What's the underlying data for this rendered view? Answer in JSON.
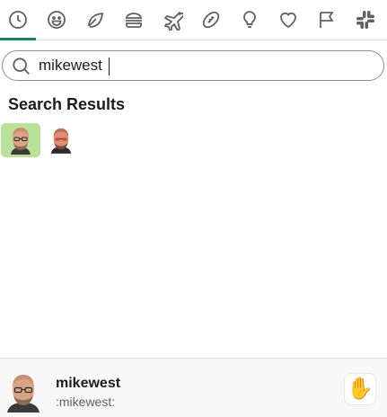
{
  "tabs": [
    {
      "icon": "clock-icon",
      "active": true
    },
    {
      "icon": "smiley-icon",
      "active": false
    },
    {
      "icon": "leaf-icon",
      "active": false
    },
    {
      "icon": "burger-icon",
      "active": false
    },
    {
      "icon": "airplane-icon",
      "active": false
    },
    {
      "icon": "football-icon",
      "active": false
    },
    {
      "icon": "lightbulb-icon",
      "active": false
    },
    {
      "icon": "heart-icon",
      "active": false
    },
    {
      "icon": "flag-icon",
      "active": false
    },
    {
      "icon": "slack-logo-icon",
      "active": false
    }
  ],
  "search": {
    "value": "mikewest",
    "placeholder": ""
  },
  "results": {
    "title": "Search Results",
    "items": [
      {
        "name": "mikewest",
        "selected": true
      },
      {
        "name": "mikewest-2",
        "selected": false
      }
    ]
  },
  "footer": {
    "name": "mikewest",
    "code": ":mikewest:",
    "skin_tone_emoji": "✋"
  },
  "colors": {
    "accent": "#1a7f64",
    "selected_bg": "#b8e29a",
    "icon": "#616061"
  }
}
